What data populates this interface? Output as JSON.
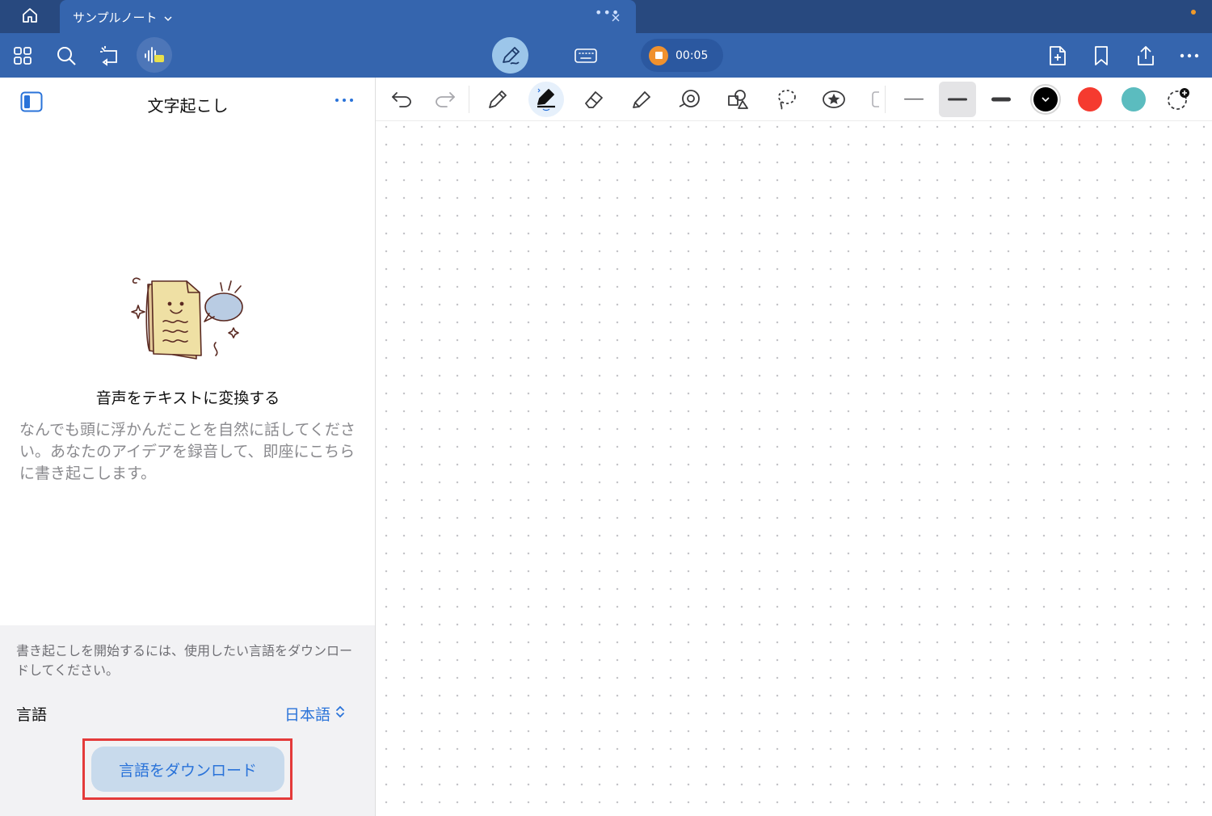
{
  "tabbar": {
    "home_icon": "home-icon",
    "tab_title": "サンプルノート",
    "tab_menu_icon": "chevron-down-icon",
    "tab_dots": "•••",
    "close_icon": "close-icon",
    "accent_color": "#f09a2a"
  },
  "toolbar": {
    "left_icons": [
      "grid-icon",
      "search-icon",
      "lasso-select-icon",
      "audio-transcribe-icon"
    ],
    "center_icons": [
      "pen-mode-icon",
      "keyboard-icon"
    ],
    "recording_time": "00:05",
    "recording_color": "#f0912e",
    "right_icons": [
      "add-page-icon",
      "bookmark-icon",
      "share-icon",
      "more-icon"
    ],
    "background_color": "#3565ae"
  },
  "panel": {
    "title": "文字起こし",
    "sidebar_icon": "sidebar-toggle-icon",
    "more_icon": "more-icon",
    "empty_title": "音声をテキストに変換する",
    "empty_description": "なんでも頭に浮かんだことを自然に話してください。あなたのアイデアを録音して、即座にこちらに書き起こします。",
    "footer_note": "書き起こしを開始するには、使用したい言語をダウンロードしてください。",
    "language_label": "言語",
    "language_value": "日本語",
    "download_button": "言語をダウンロード"
  },
  "drawbar": {
    "tools": [
      "undo-icon",
      "redo-icon",
      "pencil-icon",
      "fountain-pen-icon",
      "eraser-icon",
      "highlighter-icon",
      "shape-icon",
      "shapes-icon",
      "lasso-icon",
      "sticker-icon"
    ],
    "widths": [
      "thin",
      "medium",
      "thick"
    ],
    "selected_width": "medium",
    "colors": [
      "#000000",
      "#f53a2f",
      "#5bbcbf"
    ],
    "selected_color": "#000000",
    "add_color_icon": "add-color-icon"
  }
}
